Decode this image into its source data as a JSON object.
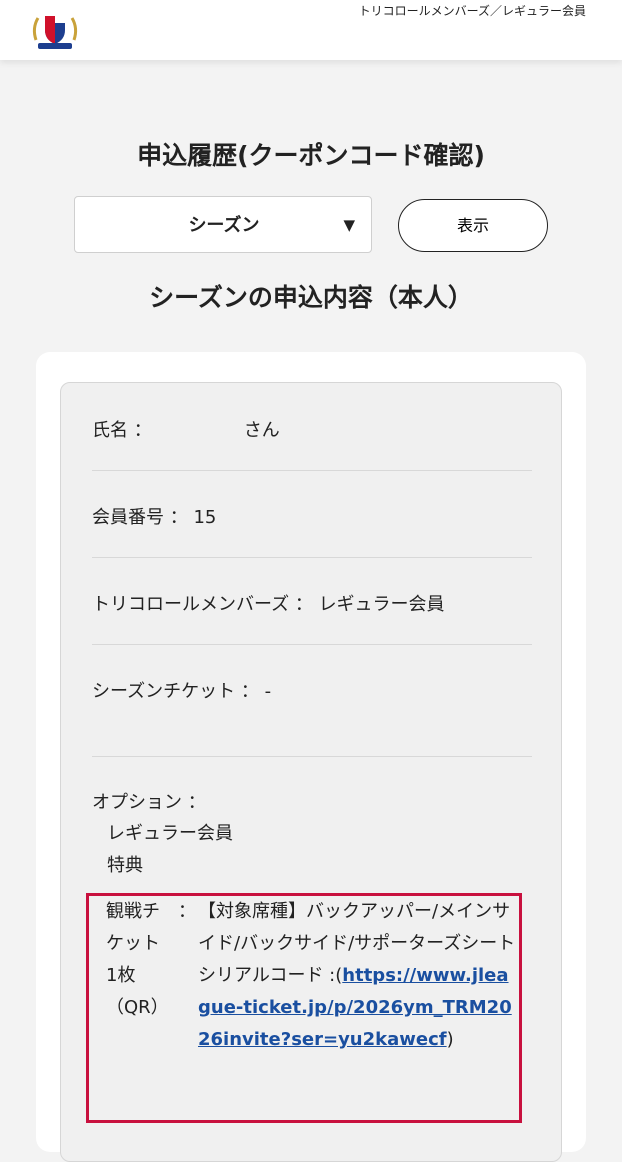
{
  "header": {
    "member_type": "トリコロールメンバーズ／レギュラー会員",
    "logo_icon": "club-crest-logo-icon"
  },
  "page": {
    "title": "申込履歴(クーポンコード確認)",
    "section_title": "シーズンの申込内容（本人）"
  },
  "filter": {
    "selected": "シーズン",
    "arrow": "▼",
    "show_button": "表示"
  },
  "details": {
    "name_label": "氏名 ：",
    "name_suffix": "さん",
    "member_number_label": "会員番号 ：",
    "member_number": "15",
    "tricolore_label": "トリコロールメンバーズ ：",
    "tricolore_value": "レギュラー会員",
    "season_ticket_label": "シーズンチケット ：",
    "season_ticket_value": "-",
    "option_label": "オプション ：",
    "option_line1": "レギュラー会員",
    "option_line2": "特典"
  },
  "ticket": {
    "label": "観戦チケット1枚（QR）",
    "colon": "：",
    "seat_text": "【対象席種】バックアッパー/メインサイド/バックサイド/サポーターズシート",
    "serial_label": "シリアルコード :(",
    "serial_link": "https://www.jleague-ticket.jp/p/2026ym_TRM2026invite?ser=yu2kawecf",
    "serial_close": ")"
  },
  "colors": {
    "highlight_border": "#c8103e",
    "link": "#1a4fa0",
    "background": "#f3f3f3"
  }
}
